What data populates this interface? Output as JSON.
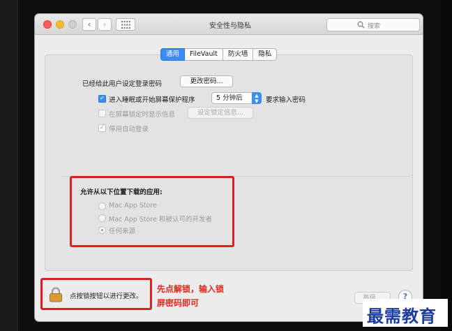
{
  "window": {
    "title": "安全性与隐私"
  },
  "search": {
    "placeholder": "搜索"
  },
  "tabs": [
    {
      "label": "通用",
      "selected": true
    },
    {
      "label": "FileVault",
      "selected": false
    },
    {
      "label": "防火墙",
      "selected": false
    },
    {
      "label": "隐私",
      "selected": false
    }
  ],
  "general": {
    "password_set_label": "已经给此用户设定登录密码",
    "change_password_button": "更改密码...",
    "require_password_label": "进入睡眠或开始屏幕保护程序",
    "require_password_delay": "5 分钟后",
    "require_password_suffix": "要求输入密码",
    "show_message_label": "在屏幕锁定时显示信息",
    "set_lock_message_button": "设定锁定信息...",
    "disable_auto_login_label": "停用自动登录"
  },
  "downloads": {
    "heading": "允许从以下位置下载的应用:",
    "options": [
      {
        "label": "Mac App Store",
        "selected": false
      },
      {
        "label": "Mac App Store 和被认可的开发者",
        "selected": false
      },
      {
        "label": "任何来源",
        "selected": true
      }
    ]
  },
  "footer": {
    "lock_text": "点按锁按钮以进行更改。",
    "advanced_button": "高级...",
    "help_button": "?"
  },
  "annotation": {
    "line1": "先点解锁，输入锁",
    "line2": "屏密码即可"
  },
  "watermark": "最需教育",
  "colors": {
    "accent": "#3b8cf5",
    "annotation": "#e8281f",
    "watermark": "#1b3c9c"
  }
}
